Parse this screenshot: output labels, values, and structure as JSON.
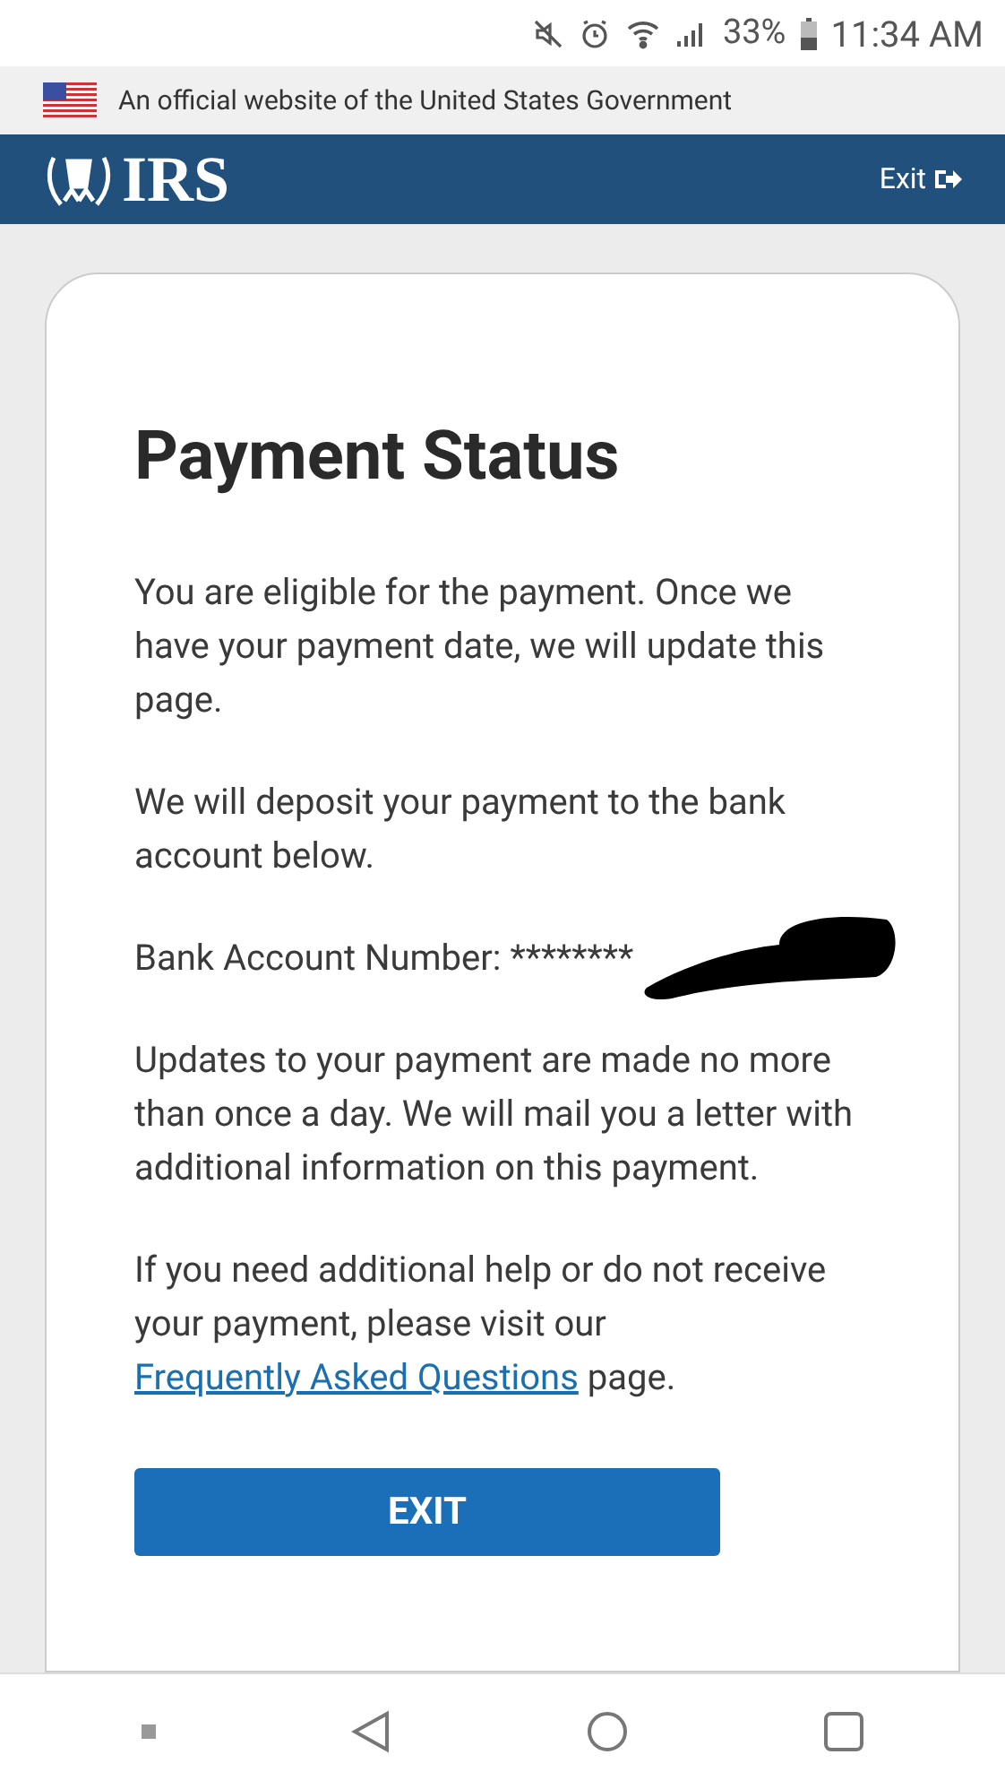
{
  "status_bar": {
    "battery": "33%",
    "time": "11:34 AM"
  },
  "gov_banner": {
    "text": "An official website of the United States Government"
  },
  "header": {
    "logo": "IRS",
    "exit": "Exit"
  },
  "card": {
    "title": "Payment Status",
    "paragraphs": [
      "You are eligible for the payment. Once we have your payment date, we will update this page.",
      "We will deposit your payment to the bank account below."
    ],
    "account": {
      "label": "Bank Account Number:",
      "value": "********"
    },
    "paragraphs_after": [
      "Updates to your payment are made no more than once a day. We will mail you a letter with additional information on this payment."
    ],
    "help": {
      "before": "If you need additional help or do not receive your payment, please visit our",
      "link": "Frequently Asked Questions",
      "after": "page."
    },
    "button": "EXIT"
  }
}
